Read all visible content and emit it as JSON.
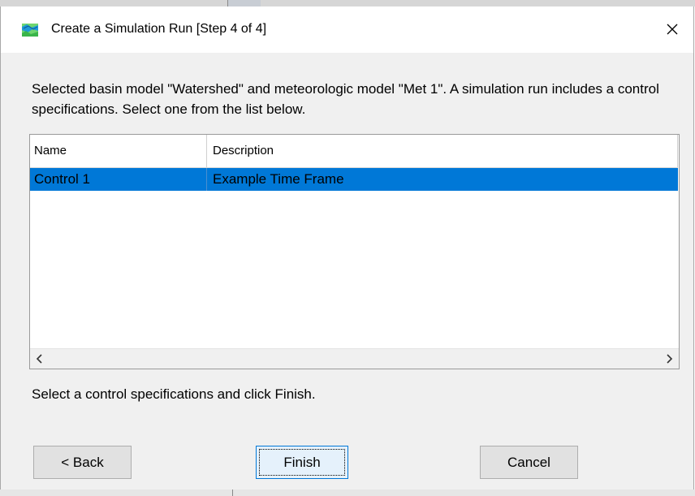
{
  "dialog": {
    "title": "Create a Simulation Run [Step 4 of 4]",
    "message": "Selected basin model \"Watershed\" and meteorologic model \"Met 1\". A simulation run includes a control specifications. Select one from the list below.",
    "hint": "Select a control specifications and click Finish."
  },
  "table": {
    "columns": [
      "Name",
      "Description"
    ],
    "rows": [
      {
        "name": "Control 1",
        "description": "Example Time Frame",
        "selected": true
      }
    ]
  },
  "buttons": {
    "back": "< Back",
    "finish": "Finish",
    "cancel": "Cancel"
  },
  "icons": {
    "app": "hec-hms-landscape-icon",
    "close": "close-icon",
    "scroll_left": "chevron-left-icon",
    "scroll_right": "chevron-right-icon"
  },
  "colors": {
    "selection": "#0078d7",
    "dialog_bg": "#f0f0f0",
    "button_bg": "#e1e1e1"
  }
}
